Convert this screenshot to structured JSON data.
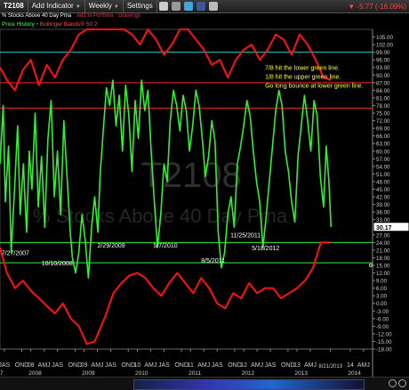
{
  "toolbar": {
    "symbol": "T2108",
    "add_indicator": "Add Indicator",
    "period": "Weekly",
    "settings": "Settings",
    "price_change": "-5.77 (-16.09%)"
  },
  "subbar": {
    "description": "% Stocks Above 40 Day Pma",
    "add_to_portfolio": "Add to Portfolio",
    "drawings": "Drawings"
  },
  "legend": {
    "price_history": "Price History",
    "bollinger": "Bollinger Bands® 50 2"
  },
  "colors": {
    "price_line": "#33ee33",
    "bollinger_line": "#ff1111",
    "upper_green": "#33ee33",
    "cyan_line": "#22cccc",
    "red_line": "#ff2222",
    "annotation": "#ffff33",
    "circle": "#ffee00"
  },
  "chart_data": {
    "type": "line",
    "title": "T2108",
    "watermark": "% Stocks Above 40 Day Pma",
    "ylim": [
      -18,
      108
    ],
    "y_ticks": [
      105,
      102,
      99,
      96,
      93,
      90,
      87,
      84,
      81,
      78,
      75,
      72,
      69,
      66,
      63,
      60,
      57,
      54,
      51,
      48,
      45,
      42,
      39,
      36,
      33,
      30,
      27,
      24,
      21,
      18,
      15,
      12,
      9,
      6,
      3,
      0,
      -3,
      -6,
      -9,
      -12,
      -15,
      -18
    ],
    "last_value": "30.17",
    "x_start": 2007.42,
    "x_end": 2014.42,
    "x_tick_labels": [
      {
        "t": 2007.5,
        "label": "JAS"
      },
      {
        "t": 2007.83,
        "label": "OND"
      },
      {
        "t": 2008.0,
        "label": "08"
      },
      {
        "t": 2008.25,
        "label": "AMJ"
      },
      {
        "t": 2008.5,
        "label": "JAS"
      },
      {
        "t": 2008.83,
        "label": "OND"
      },
      {
        "t": 2009.0,
        "label": "09"
      },
      {
        "t": 2009.25,
        "label": "AMJ"
      },
      {
        "t": 2009.5,
        "label": "JAS"
      },
      {
        "t": 2009.83,
        "label": "OND"
      },
      {
        "t": 2010.0,
        "label": "10"
      },
      {
        "t": 2010.25,
        "label": "AMJ"
      },
      {
        "t": 2010.5,
        "label": "JAS"
      },
      {
        "t": 2010.83,
        "label": "OND"
      },
      {
        "t": 2011.0,
        "label": "11"
      },
      {
        "t": 2011.25,
        "label": "AMJ"
      },
      {
        "t": 2011.5,
        "label": "JAS"
      },
      {
        "t": 2011.83,
        "label": "OND"
      },
      {
        "t": 2012.0,
        "label": "12"
      },
      {
        "t": 2012.25,
        "label": "AMJ"
      },
      {
        "t": 2012.5,
        "label": "JAS"
      },
      {
        "t": 2012.83,
        "label": "OND"
      },
      {
        "t": 2013.0,
        "label": "13"
      },
      {
        "t": 2013.25,
        "label": "AMJ"
      },
      {
        "t": 2013.63,
        "label": "8/21/2013"
      },
      {
        "t": 2014.0,
        "label": "14"
      },
      {
        "t": 2014.25,
        "label": "AMJ"
      }
    ],
    "year_labels": [
      {
        "t": 2007.42,
        "label": "07"
      },
      {
        "t": 2008.08,
        "label": "2008"
      },
      {
        "t": 2009.08,
        "label": "2009"
      },
      {
        "t": 2010.08,
        "label": "2010"
      },
      {
        "t": 2011.08,
        "label": "2011"
      },
      {
        "t": 2012.08,
        "label": "2012"
      },
      {
        "t": 2013.08,
        "label": "2013"
      },
      {
        "t": 2014.08,
        "label": "2014"
      }
    ],
    "horizontal_lines": [
      {
        "y": 99,
        "color": "#22cccc"
      },
      {
        "y": 87,
        "color": "#ff2222"
      },
      {
        "y": 77,
        "color": "#ff2222"
      },
      {
        "y": 24,
        "color": "#33ee33"
      },
      {
        "y": 16,
        "color": "#33ee33"
      }
    ],
    "annotations": [
      {
        "t": 2007.45,
        "y": 19,
        "text": "7/27/2007",
        "color": "#ffffff"
      },
      {
        "t": 2008.2,
        "y": 15,
        "text": "10/10/2008",
        "color": "#ffffff"
      },
      {
        "t": 2009.25,
        "y": 22,
        "text": "2/29/2009",
        "color": "#ffffff"
      },
      {
        "t": 2010.3,
        "y": 22,
        "text": "5/7/2010",
        "color": "#ffffff"
      },
      {
        "t": 2011.2,
        "y": 16,
        "text": "8/5/2011",
        "color": "#ffffff"
      },
      {
        "t": 2011.75,
        "y": 26,
        "text": "11/25/2011",
        "color": "#ffffff"
      },
      {
        "t": 2012.15,
        "y": 21,
        "text": "5/18/2012",
        "color": "#ffffff"
      },
      {
        "t": 2012.4,
        "y": 92,
        "text": "7/8 hit the lower green line.",
        "color": "#ffff33"
      },
      {
        "t": 2012.4,
        "y": 88.5,
        "text": "1/8 hit the upper green line.",
        "color": "#ffff33"
      },
      {
        "t": 2012.4,
        "y": 85,
        "text": "Go long bounce at lower green line.",
        "color": "#ffff33"
      }
    ],
    "circle": {
      "t": 2013.95,
      "y": 21,
      "rt": 0.35,
      "ry": 5.5
    },
    "series": [
      {
        "name": "Price History",
        "color": "#33ee33",
        "x": [
          2007.42,
          2007.48,
          2007.52,
          2007.58,
          2007.63,
          2007.7,
          2007.75,
          2007.8,
          2007.86,
          2007.92,
          2007.97,
          2008.02,
          2008.08,
          2008.14,
          2008.2,
          2008.26,
          2008.32,
          2008.38,
          2008.44,
          2008.5,
          2008.56,
          2008.62,
          2008.68,
          2008.74,
          2008.78,
          2008.84,
          2008.9,
          2008.96,
          2009.02,
          2009.08,
          2009.14,
          2009.2,
          2009.26,
          2009.3,
          2009.36,
          2009.42,
          2009.48,
          2009.54,
          2009.6,
          2009.66,
          2009.72,
          2009.78,
          2009.84,
          2009.9,
          2009.96,
          2010.02,
          2010.08,
          2010.14,
          2010.2,
          2010.26,
          2010.32,
          2010.38,
          2010.44,
          2010.5,
          2010.56,
          2010.62,
          2010.68,
          2010.74,
          2010.8,
          2010.86,
          2010.92,
          2010.98,
          2011.04,
          2011.1,
          2011.16,
          2011.22,
          2011.28,
          2011.34,
          2011.4,
          2011.46,
          2011.52,
          2011.58,
          2011.64,
          2011.7,
          2011.76,
          2011.82,
          2011.88,
          2011.94,
          2012.0,
          2012.06,
          2012.12,
          2012.18,
          2012.24,
          2012.3,
          2012.36,
          2012.42,
          2012.48,
          2012.54,
          2012.6,
          2012.66,
          2012.72,
          2012.78,
          2012.84,
          2012.9,
          2012.96,
          2013.02,
          2013.08,
          2013.14,
          2013.2,
          2013.26,
          2013.32,
          2013.38,
          2013.44,
          2013.5,
          2013.55,
          2013.6,
          2013.64
        ],
        "y": [
          55,
          78,
          40,
          62,
          20,
          48,
          70,
          35,
          55,
          28,
          60,
          45,
          75,
          38,
          58,
          30,
          65,
          80,
          42,
          60,
          35,
          72,
          50,
          28,
          18,
          12,
          20,
          35,
          25,
          10,
          30,
          42,
          28,
          50,
          68,
          85,
          78,
          88,
          70,
          82,
          60,
          86,
          74,
          52,
          80,
          65,
          88,
          76,
          84,
          60,
          40,
          22,
          35,
          55,
          48,
          72,
          84,
          78,
          68,
          82,
          76,
          60,
          70,
          84,
          78,
          65,
          50,
          58,
          72,
          64,
          28,
          14,
          20,
          35,
          42,
          30,
          55,
          62,
          70,
          80,
          74,
          60,
          48,
          40,
          22,
          34,
          48,
          62,
          76,
          84,
          78,
          60,
          52,
          40,
          32,
          58,
          70,
          82,
          72,
          60,
          80,
          74,
          50,
          38,
          62,
          48,
          30.17
        ]
      },
      {
        "name": "Bollinger Bands® 50 2",
        "color": "#ff1111",
        "x": [
          2007.42,
          2007.55,
          2007.7,
          2007.85,
          2008.0,
          2008.15,
          2008.3,
          2008.45,
          2008.6,
          2008.75,
          2008.9,
          2009.05,
          2009.2,
          2009.3,
          2009.4,
          2009.55,
          2009.7,
          2009.85,
          2010.0,
          2010.15,
          2010.3,
          2010.45,
          2010.6,
          2010.75,
          2010.9,
          2011.05,
          2011.2,
          2011.35,
          2011.5,
          2011.65,
          2011.8,
          2011.95,
          2012.1,
          2012.25,
          2012.4,
          2012.55,
          2012.7,
          2012.85,
          2013.0,
          2013.15,
          2013.3,
          2013.45,
          2013.6,
          2013.64
        ],
        "y": [
          22,
          12,
          6,
          9,
          5,
          2,
          -1,
          -4,
          0,
          -6,
          -9,
          -16,
          -15,
          -10,
          -5,
          4,
          8,
          11,
          12,
          10,
          6,
          3,
          8,
          12,
          8,
          4,
          10,
          6,
          0,
          -2,
          4,
          2,
          8,
          4,
          6,
          6,
          2,
          4,
          6,
          9,
          14,
          24,
          24,
          24
        ]
      },
      {
        "name": "",
        "color": "#ff1111",
        "x": [
          2007.42,
          2007.55,
          2007.7,
          2007.85,
          2008.0,
          2008.15,
          2008.3,
          2008.45,
          2008.6,
          2008.75,
          2008.9,
          2009.05,
          2009.2,
          2009.3,
          2009.45,
          2009.6,
          2009.75,
          2009.9,
          2010.05,
          2010.2,
          2010.35,
          2010.5,
          2010.65,
          2010.8,
          2010.95,
          2011.1,
          2011.25,
          2011.4,
          2011.55,
          2011.7,
          2011.85,
          2012.0,
          2012.15,
          2012.3,
          2012.45,
          2012.6,
          2012.75,
          2012.9,
          2013.05,
          2013.2,
          2013.35,
          2013.5,
          2013.64
        ],
        "y": [
          93,
          88,
          84,
          92,
          96,
          86,
          94,
          89,
          96,
          100,
          106,
          108,
          108,
          108,
          108,
          108,
          108,
          106,
          102,
          108,
          104,
          98,
          102,
          108,
          108,
          104,
          100,
          94,
          96,
          89,
          96,
          100,
          102,
          96,
          100,
          106,
          104,
          98,
          106,
          102,
          96,
          89,
          88
        ]
      }
    ]
  }
}
